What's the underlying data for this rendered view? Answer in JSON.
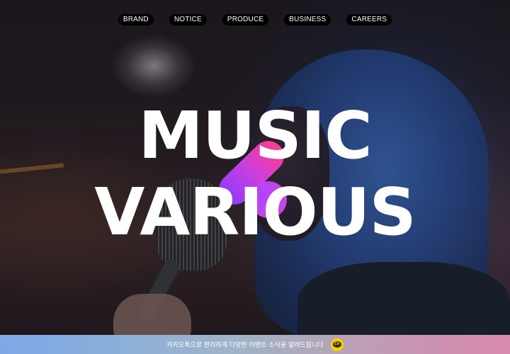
{
  "nav": {
    "items": [
      {
        "label": "BRAND"
      },
      {
        "label": "NOTICE"
      },
      {
        "label": "PRODUCE"
      },
      {
        "label": "BUSINESS"
      },
      {
        "label": "CAREERS"
      }
    ]
  },
  "hero": {
    "title_line1": "MUSIC",
    "title_line2": "VARIOUS"
  },
  "banner": {
    "text": "카카오톡으로 편리하게 다양한 이벤트 소식을 알려드립니다",
    "icon": "kakao-channel-icon",
    "icon_text": "Ch"
  },
  "colors": {
    "brush_start": "#8a3bff",
    "brush_end": "#ff3c8e",
    "kakao_yellow": "#f5d400"
  }
}
